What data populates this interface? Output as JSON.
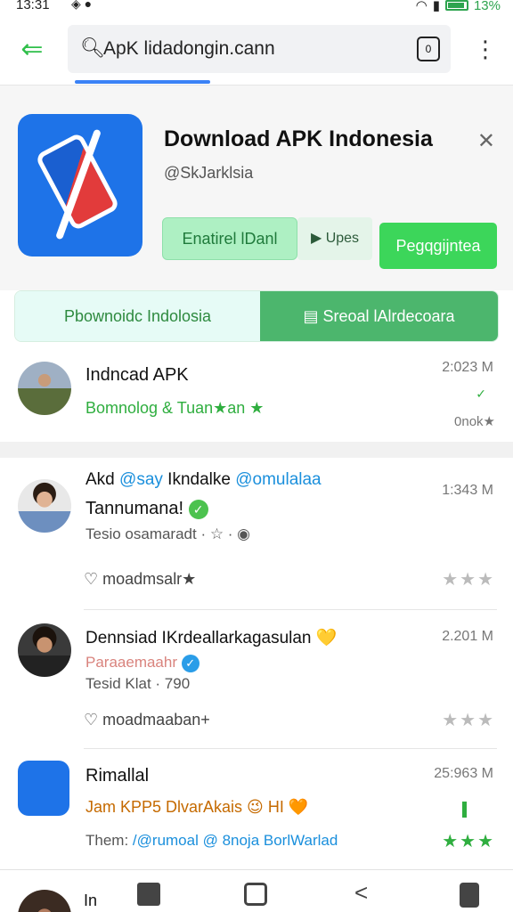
{
  "status": {
    "time": "13:31",
    "left_icons": "◈ ●",
    "battery_text": "13%"
  },
  "topbar": {
    "search_value": "ApK lidadongin.cann",
    "cam_label": "0"
  },
  "promo": {
    "title": "Download APK Indonesia",
    "subtitle": "@SkJarklsia",
    "btn_left": "Enatirel lDanl",
    "btn_mid": "▶ Upes",
    "btn_right": "Pegqgijntea"
  },
  "segment": {
    "left": "Pbownoidc Indolosia",
    "right": "Sreoal lAlrdecoara"
  },
  "items": [
    {
      "title": "Indncad APK",
      "green": "Bomnolog & Tuan★an ★",
      "meta_time": "2:023 M",
      "meta_bottom": "0nok★"
    },
    {
      "title_prefix": "Akd",
      "title_mid": "@say",
      "title_mid2": "Ikndalke",
      "title_mid3": "@omulalaa",
      "line2": "Tannumana!",
      "sub": "Tesio osamaradt · ☆ · ◉",
      "meta_time": "1:343 M",
      "comment": "moadmsalr★"
    },
    {
      "title": "Dennsiad IKrdeallarkagasulan",
      "pink": "Paraaemaahr",
      "sub": "Tesid Klat · 790",
      "meta_time": "2.201 M",
      "comment": "moadmaaban+"
    },
    {
      "title": "Rimallal",
      "orange": "Jam KPP5 DlvarAkais 😉 HI 🧡",
      "sub_prefix": "Them:",
      "sub_rest": "/@rumoal @ 8noja BorlWarlad",
      "meta_time": "25:963 M"
    }
  ],
  "bottom": {
    "label": "In"
  }
}
